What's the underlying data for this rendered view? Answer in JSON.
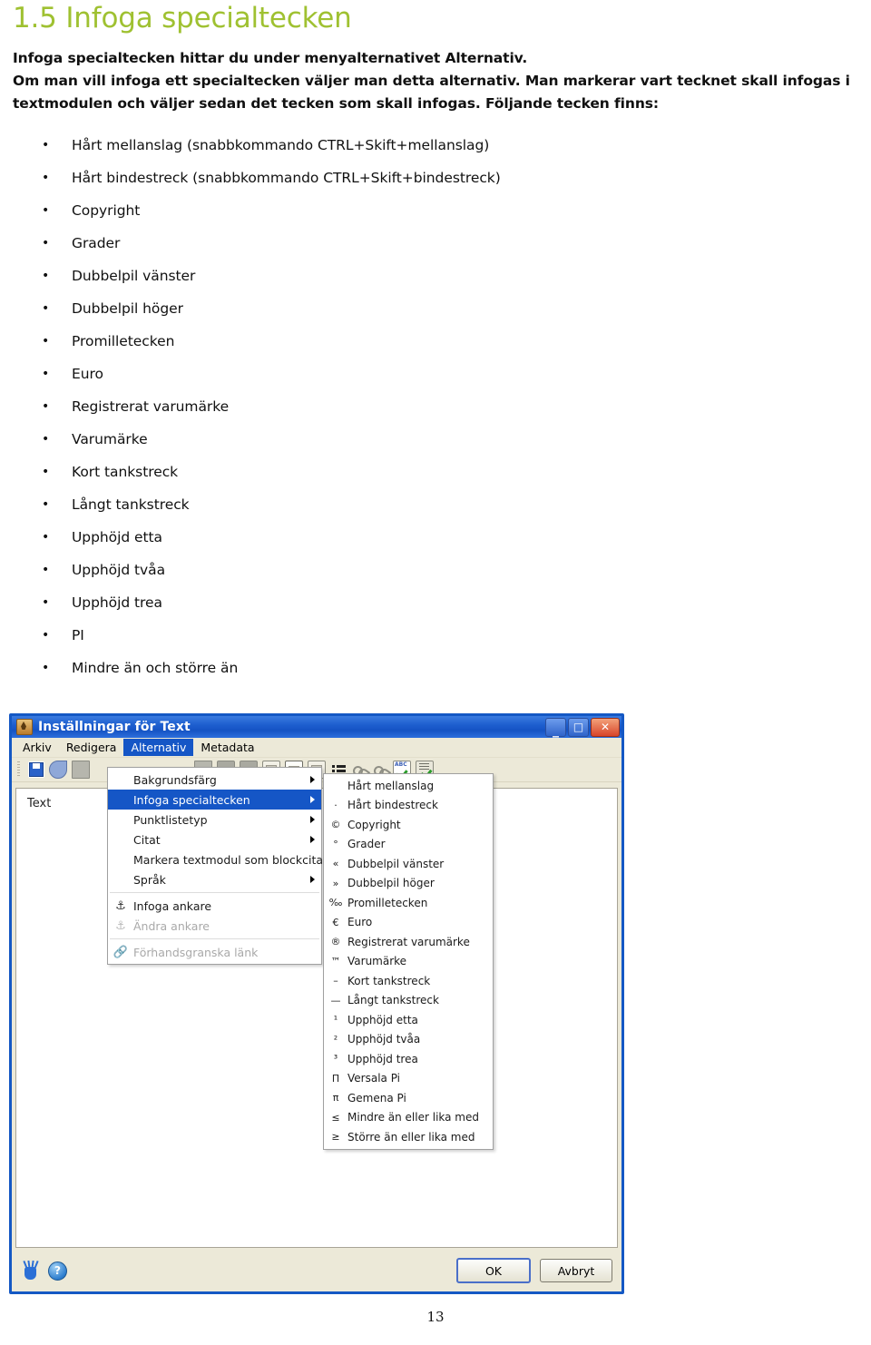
{
  "document": {
    "heading": "1.5 Infoga specialtecken",
    "intro_lines": [
      "Infoga specialtecken hittar du under menyalternativet Alternativ.",
      "Om man vill infoga ett specialtecken väljer man detta alternativ. Man markerar vart tecknet skall infogas i",
      "textmodulen och väljer sedan det tecken som skall infogas. Följande tecken finns:"
    ],
    "bullets": [
      "Hårt mellanslag (snabbkommando CTRL+Skift+mellanslag)",
      "Hårt bindestreck (snabbkommando CTRL+Skift+bindestreck)",
      "Copyright",
      "Grader",
      "Dubbelpil vänster",
      "Dubbelpil höger",
      "Promilletecken",
      "Euro",
      "Registrerat varumärke",
      "Varumärke",
      "Kort tankstreck",
      "Långt tankstreck",
      "Upphöjd etta",
      "Upphöjd tvåa",
      "Upphöjd trea",
      "PI",
      "Mindre än och större än"
    ],
    "page_number": "13",
    "heading_color": "#9FC131"
  },
  "dialog": {
    "title": "Inställningar för Text",
    "window_buttons": {
      "minimize": "_",
      "maximize": "□",
      "close": "✕"
    },
    "menubar": [
      {
        "label": "Arkiv",
        "active": false
      },
      {
        "label": "Redigera",
        "active": false
      },
      {
        "label": "Alternativ",
        "active": true
      },
      {
        "label": "Metadata",
        "active": false
      }
    ],
    "toolbar_icons": [
      "save-icon",
      "cut-icon",
      "copy-icon",
      "paste-icon",
      "image-icon",
      "table-icon",
      "textbox-icon",
      "textbox-selected-icon",
      "textbox-alt-icon",
      "bullet-list-icon",
      "insert-link-icon",
      "edit-link-icon",
      "spellcheck-icon",
      "document-check-icon"
    ],
    "content_label": "Text",
    "footer": {
      "hand_icon": "sign-language-icon",
      "help_icon": "help-icon",
      "ok_label": "OK",
      "cancel_label": "Avbryt"
    },
    "menu": {
      "items": [
        {
          "icon": "",
          "label": "Bakgrundsfärg",
          "submenu": true,
          "selected": false,
          "disabled": false
        },
        {
          "icon": "",
          "label": "Infoga specialtecken",
          "submenu": true,
          "selected": true,
          "disabled": false
        },
        {
          "icon": "",
          "label": "Punktlistetyp",
          "submenu": true,
          "selected": false,
          "disabled": false
        },
        {
          "icon": "",
          "label": "Citat",
          "submenu": true,
          "selected": false,
          "disabled": false
        },
        {
          "icon": "",
          "label": "Markera textmodul som blockcitat",
          "submenu": false,
          "selected": false,
          "disabled": false
        },
        {
          "icon": "",
          "label": "Språk",
          "submenu": true,
          "selected": false,
          "disabled": false
        },
        {
          "separator": true
        },
        {
          "icon": "⚓",
          "label": "Infoga ankare",
          "submenu": false,
          "selected": false,
          "disabled": false
        },
        {
          "icon": "⚓",
          "label": "Ändra ankare",
          "submenu": false,
          "selected": false,
          "disabled": true
        },
        {
          "separator": true
        },
        {
          "icon": "🔗",
          "label": "Förhandsgranska länk",
          "submenu": false,
          "selected": false,
          "disabled": true
        }
      ]
    },
    "submenu": {
      "items": [
        {
          "icon": "",
          "label": "Hårt mellanslag"
        },
        {
          "icon": "‧",
          "label": "Hårt bindestreck"
        },
        {
          "icon": "©",
          "label": "Copyright"
        },
        {
          "icon": "°",
          "label": "Grader"
        },
        {
          "icon": "«",
          "label": "Dubbelpil vänster"
        },
        {
          "icon": "»",
          "label": "Dubbelpil höger"
        },
        {
          "icon": "‰",
          "label": "Promilletecken"
        },
        {
          "icon": "€",
          "label": "Euro"
        },
        {
          "icon": "®",
          "label": "Registrerat varumärke"
        },
        {
          "icon": "™",
          "label": "Varumärke"
        },
        {
          "icon": "–",
          "label": "Kort tankstreck"
        },
        {
          "icon": "—",
          "label": "Långt tankstreck"
        },
        {
          "icon": "¹",
          "label": "Upphöjd etta"
        },
        {
          "icon": "²",
          "label": "Upphöjd tvåa"
        },
        {
          "icon": "³",
          "label": "Upphöjd trea"
        },
        {
          "icon": "Π",
          "label": "Versala Pi"
        },
        {
          "icon": "π",
          "label": "Gemena Pi"
        },
        {
          "icon": "≤",
          "label": "Mindre än eller lika med"
        },
        {
          "icon": "≥",
          "label": "Större än eller lika med"
        }
      ]
    },
    "tooltip": "Hårt mellanslag"
  }
}
